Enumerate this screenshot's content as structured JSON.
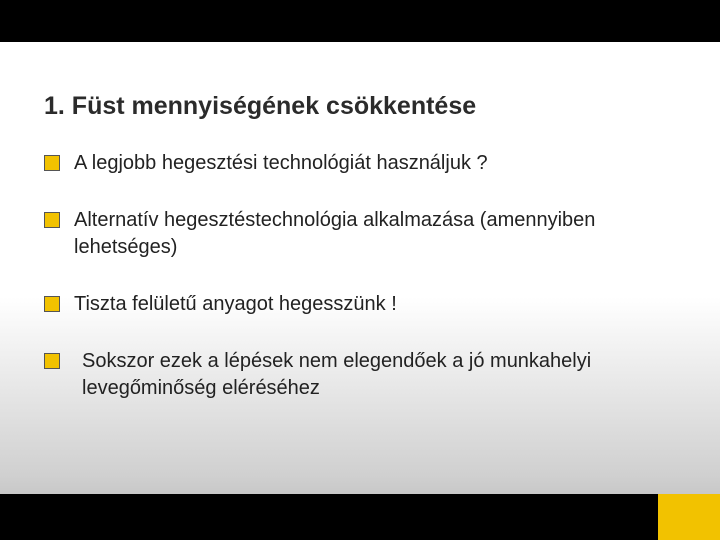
{
  "slide": {
    "title": "1. Füst mennyiségének csökkentése",
    "items": [
      "A legjobb hegesztési technológiát használjuk ?",
      "Alternatív hegesztéstechnológia alkalmazása (amennyiben lehetséges)",
      "Tiszta felületű anyagot hegesszünk !",
      " Sokszor ezek a lépések nem elegendőek a jó munkahelyi levegőminőség eléréséhez"
    ]
  },
  "colors": {
    "accent": "#f2c200",
    "bar": "#000000"
  }
}
